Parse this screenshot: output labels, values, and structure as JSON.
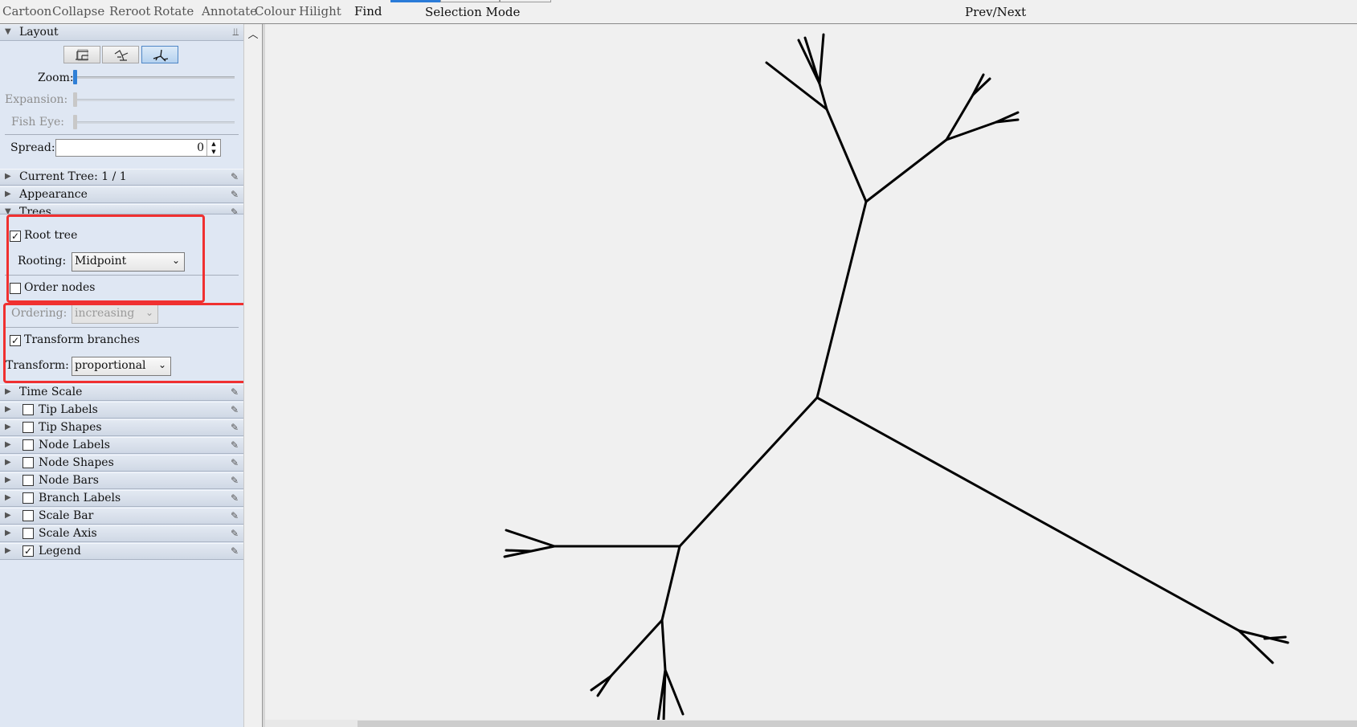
{
  "toolbar": {
    "buttons": [
      "Cartoon",
      "Collapse",
      "Reroot",
      "Rotate",
      "Annotate",
      "Colour",
      "Hilight"
    ],
    "find": "Find",
    "selection_mode": "Selection Mode",
    "prev_next": "Prev/Next"
  },
  "layout": {
    "title": "Layout",
    "zoom_label": "Zoom:",
    "expansion_label": "Expansion:",
    "fisheye_label": "Fish Eye:",
    "spread_label": "Spread:",
    "spread_value": "0",
    "zoom_level": 0,
    "selected_layout": "radial"
  },
  "sections": {
    "current_tree": "Current Tree: 1 / 1",
    "appearance": "Appearance",
    "trees": "Trees",
    "time_scale": "Time Scale",
    "tip_labels": "Tip Labels",
    "tip_shapes": "Tip Shapes",
    "node_labels": "Node Labels",
    "node_shapes": "Node Shapes",
    "node_bars": "Node Bars",
    "branch_labels": "Branch Labels",
    "scale_bar": "Scale Bar",
    "scale_axis": "Scale Axis",
    "legend": "Legend"
  },
  "section_checked": {
    "tip_labels": false,
    "tip_shapes": false,
    "node_labels": false,
    "node_shapes": false,
    "node_bars": false,
    "branch_labels": false,
    "scale_bar": false,
    "scale_axis": false,
    "legend": true
  },
  "trees": {
    "root_tree_label": "Root tree",
    "root_tree_checked": true,
    "rooting_label": "Rooting:",
    "rooting_value": "Midpoint",
    "order_nodes_label": "Order nodes",
    "order_nodes_checked": false,
    "ordering_label": "Ordering:",
    "ordering_value": "increasing",
    "transform_branches_label": "Transform branches",
    "transform_branches_checked": true,
    "transform_label": "Transform:",
    "transform_value": "proportional"
  },
  "icons": {
    "pin": "pin-icon",
    "collapse": "triangle-down-icon",
    "expand": "triangle-right-icon",
    "check": "check-icon"
  },
  "colors": {
    "highlight_box": "#f03030",
    "accent": "#2f7fd6",
    "panel_bg": "#dfe7f3",
    "tree_stroke": "#000000"
  }
}
